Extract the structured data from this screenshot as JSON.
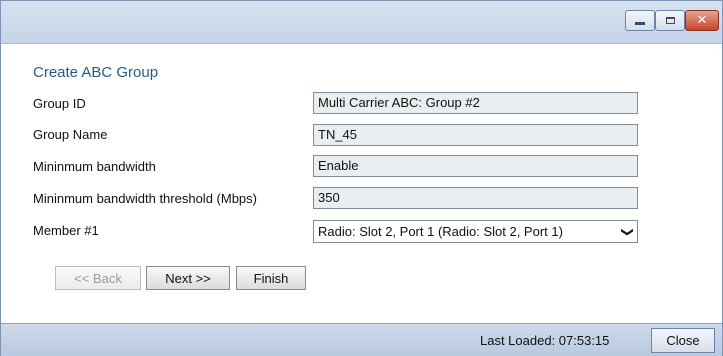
{
  "window": {
    "controls": {
      "minimize_icon": "minimize-icon",
      "maximize_icon": "maximize-icon",
      "close_icon": "close-icon",
      "close_glyph": "✕"
    }
  },
  "form": {
    "title": "Create ABC Group",
    "rows": [
      {
        "label": "Group ID",
        "value": "Multi Carrier ABC: Group #2"
      },
      {
        "label": "Group Name",
        "value": "TN_45"
      },
      {
        "label": "Mininmum bandwidth",
        "value": "Enable"
      },
      {
        "label": "Mininmum bandwidth threshold (Mbps)",
        "value": "350"
      }
    ],
    "member": {
      "label": "Member #1",
      "selected": "Radio: Slot 2, Port 1 (Radio: Slot 2, Port 1)",
      "chevron": "❯"
    }
  },
  "buttons": {
    "back": "<< Back",
    "next": "Next >>",
    "finish": "Finish"
  },
  "footer": {
    "last_loaded": "Last Loaded: 07:53:15",
    "close": "Close"
  },
  "colors": {
    "title": "#2a5a8c",
    "titlebar": "#c6d4e8",
    "footer": "#b9c9e0",
    "close_button": "#c9452c"
  }
}
